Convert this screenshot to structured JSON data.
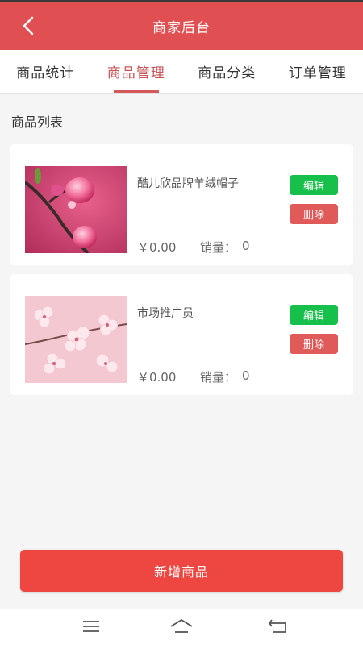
{
  "header": {
    "title": "商家后台"
  },
  "tabs": [
    {
      "label": "商品统计"
    },
    {
      "label": "商品管理"
    },
    {
      "label": "商品分类"
    },
    {
      "label": "订单管理"
    }
  ],
  "section": {
    "title": "商品列表"
  },
  "products": [
    {
      "name": "酷儿欣品牌羊绒帽子",
      "price": "￥0.00",
      "sales_label": "销量：",
      "sales": "0",
      "edit_label": "编辑",
      "delete_label": "删除"
    },
    {
      "name": "市场推广员",
      "price": "￥0.00",
      "sales_label": "销量：",
      "sales": "0",
      "edit_label": "编辑",
      "delete_label": "删除"
    }
  ],
  "add_button": {
    "label": "新增商品"
  },
  "colors": {
    "header": "#e05052",
    "active_tab": "#c95457",
    "edit": "#17c04a",
    "delete": "#e05a5a",
    "add": "#ee4640"
  },
  "icons": {
    "back": "chevron-left-icon",
    "nav_menu": "menu-icon",
    "nav_home": "home-icon",
    "nav_back": "return-icon"
  }
}
